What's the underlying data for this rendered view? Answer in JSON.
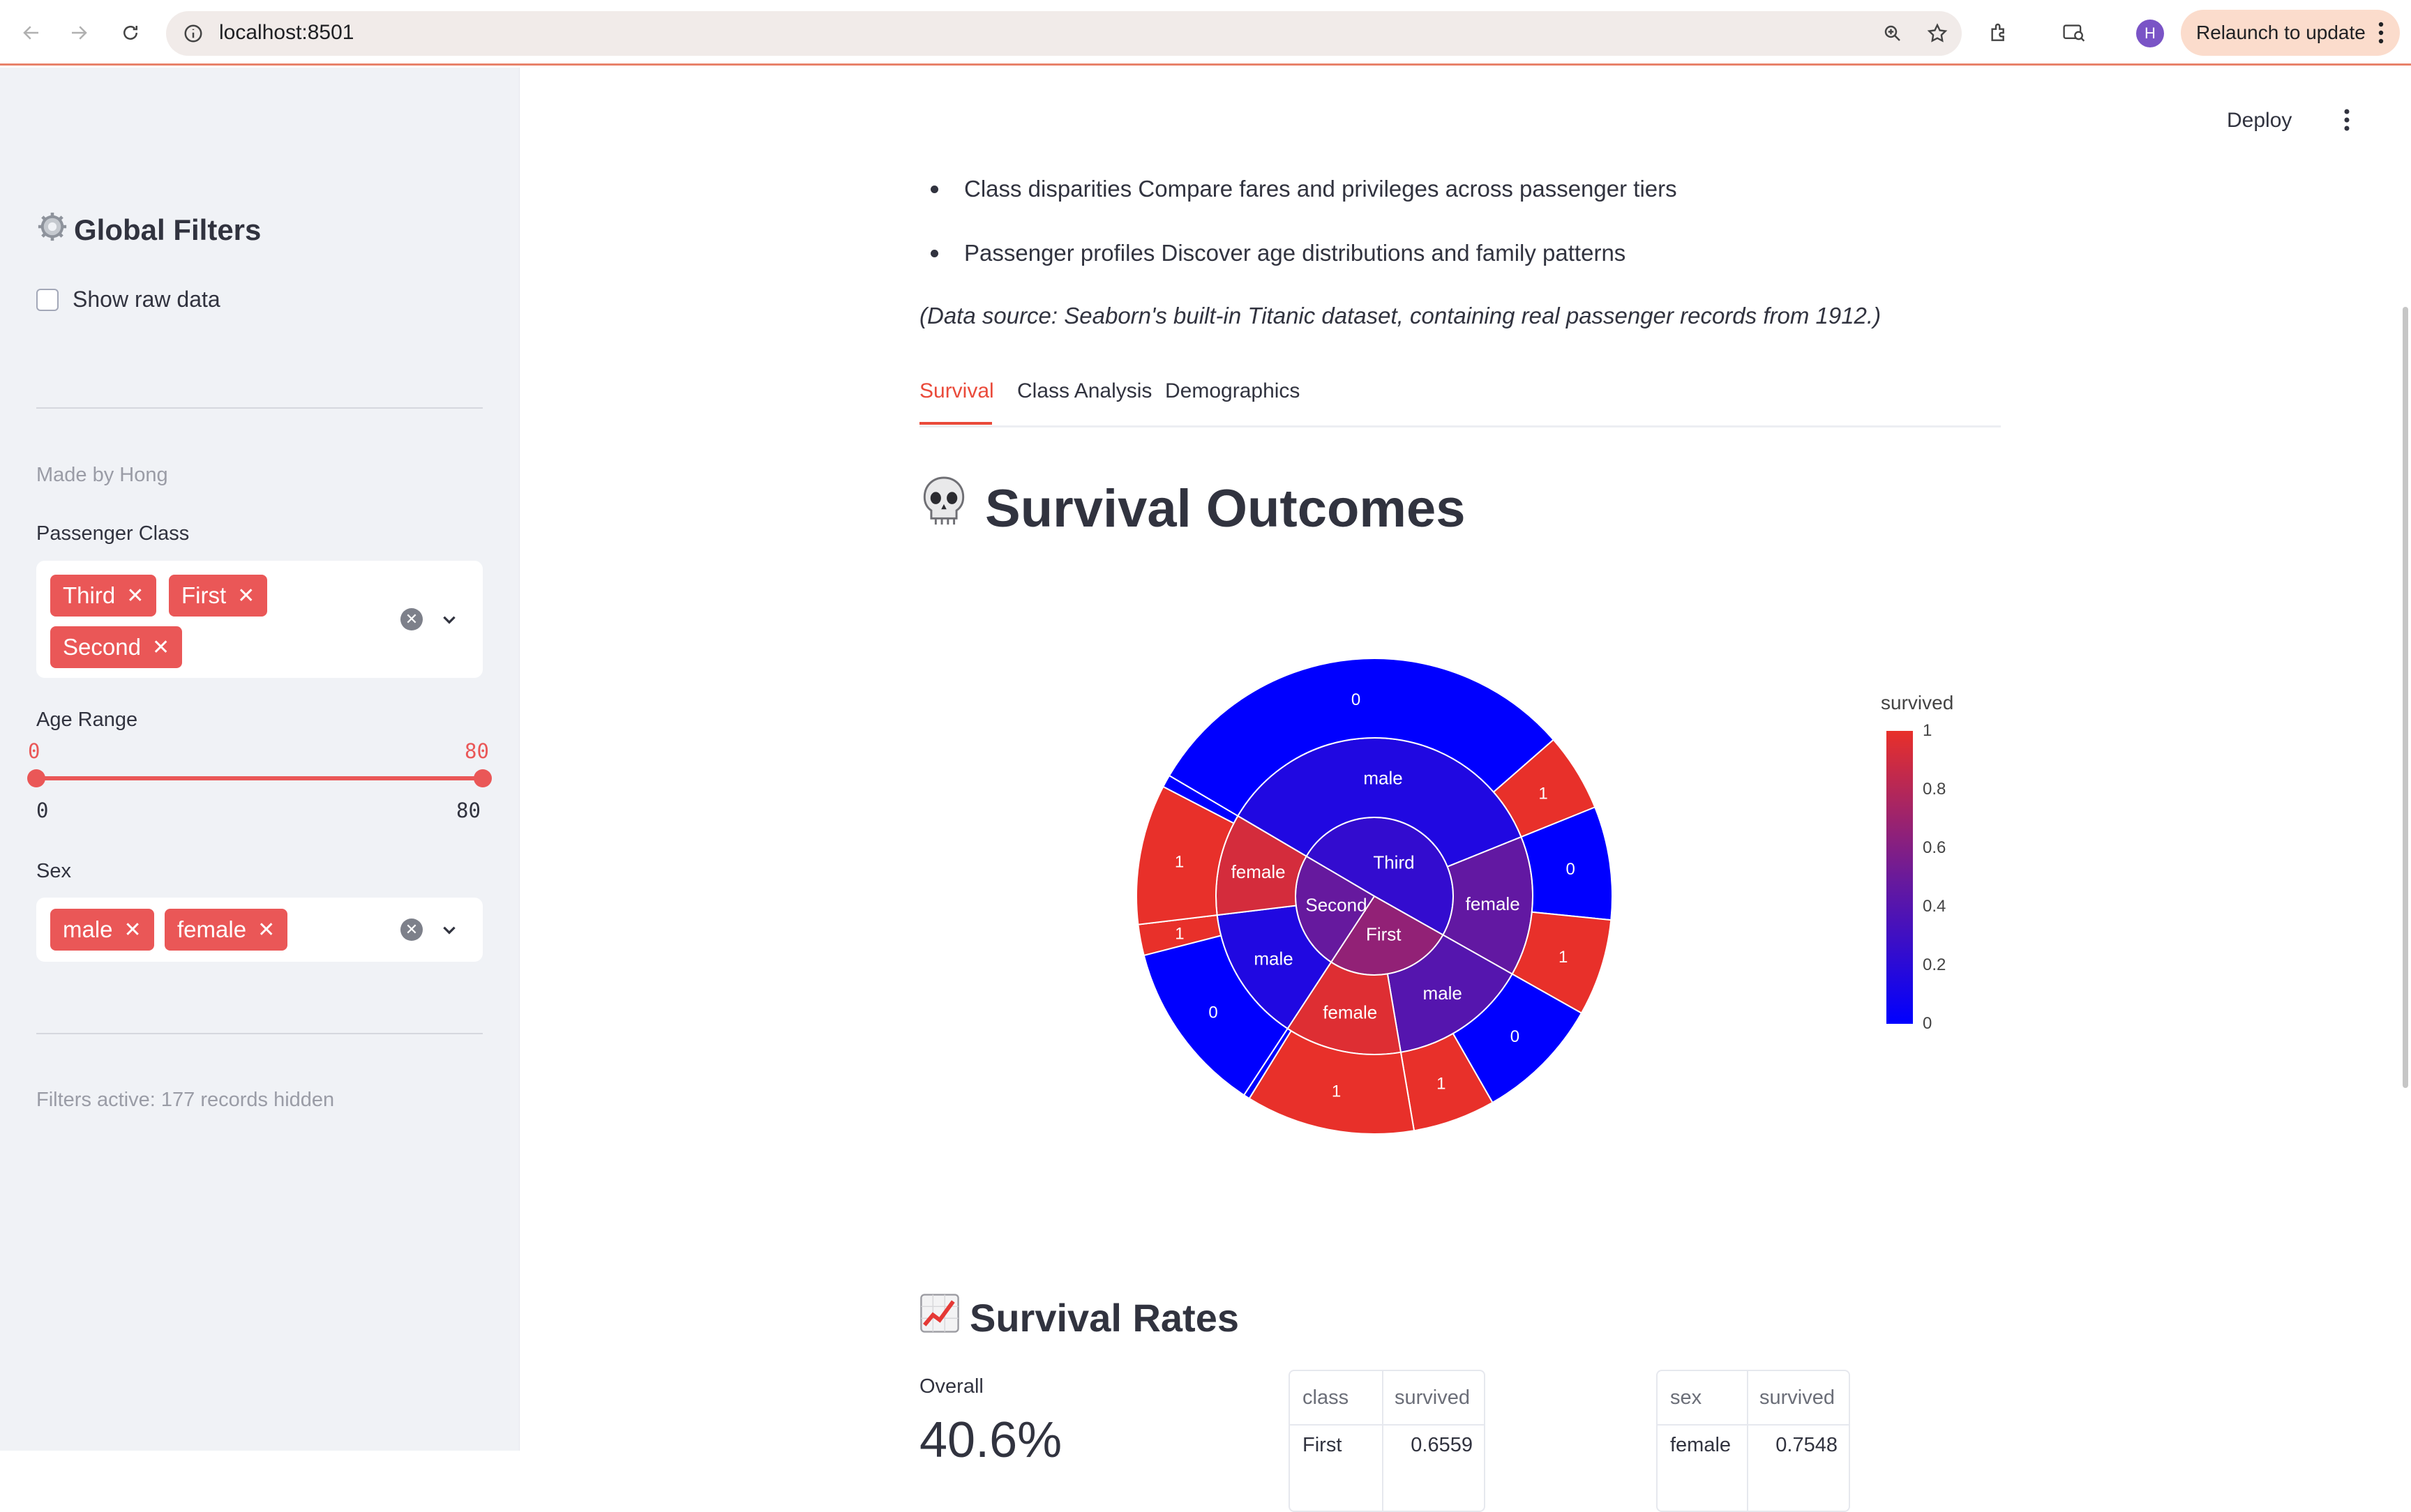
{
  "browser": {
    "url": "localhost:8501",
    "relaunch_label": "Relaunch to update",
    "profile_initial": "H"
  },
  "sidebar": {
    "title": "Global Filters",
    "show_raw_data_label": "Show raw data",
    "made_by": "Made by Hong",
    "passenger_class": {
      "label": "Passenger Class",
      "selected": [
        "Third",
        "First",
        "Second"
      ]
    },
    "age_range": {
      "label": "Age Range",
      "min_value": "0",
      "max_value": "80",
      "scale_min": "0",
      "scale_max": "80"
    },
    "sex": {
      "label": "Sex",
      "selected": [
        "male",
        "female"
      ]
    },
    "filters_status": "Filters active: 177 records hidden"
  },
  "main": {
    "deploy_label": "Deploy",
    "bullets": [
      "Class disparities Compare fares and privileges across passenger tiers",
      "Passenger profiles Discover age distributions and family patterns"
    ],
    "data_source": "(Data source: Seaborn's built-in Titanic dataset, containing real passenger records from 1912.)",
    "tabs": [
      "Survival",
      "Class Analysis",
      "Demographics"
    ],
    "active_tab": "Survival",
    "survival_heading": "Survival Outcomes",
    "rates_heading": "Survival Rates",
    "overall_label": "Overall",
    "overall_value": "40.6%",
    "class_table": {
      "headers": [
        "class",
        "survived"
      ],
      "first_row": [
        "First",
        "0.6559"
      ]
    },
    "sex_table": {
      "headers": [
        "sex",
        "survived"
      ],
      "first_row": [
        "female",
        "0.7548"
      ]
    }
  },
  "chart_data": {
    "type": "sunburst",
    "colorbar_title": "survived",
    "colorbar_ticks": [
      "1",
      "0.8",
      "0.6",
      "0.4",
      "0.2",
      "0"
    ],
    "colorscale": [
      "#0000ff",
      "#e8302a"
    ],
    "hierarchy": [
      {
        "label": "Third",
        "value": 355,
        "color_value": 0.24,
        "children": [
          {
            "label": "male",
            "value": 253,
            "color_value": 0.15,
            "children": [
              {
                "label": "0",
                "value": 215
              },
              {
                "label": "1",
                "value": 38
              }
            ]
          },
          {
            "label": "female",
            "value": 102,
            "color_value": 0.46,
            "children": [
              {
                "label": "0",
                "value": 55
              },
              {
                "label": "1",
                "value": 47
              }
            ]
          }
        ]
      },
      {
        "label": "First",
        "value": 186,
        "color_value": 0.66,
        "children": [
          {
            "label": "male",
            "value": 101,
            "color_value": 0.4,
            "children": [
              {
                "label": "0",
                "value": 61
              },
              {
                "label": "1",
                "value": 40
              }
            ]
          },
          {
            "label": "female",
            "value": 85,
            "color_value": 0.96,
            "children": [
              {
                "label": "1",
                "value": 82
              },
              {
                "label": "0",
                "value": 3
              }
            ]
          }
        ]
      },
      {
        "label": "Second",
        "value": 173,
        "color_value": 0.48,
        "children": [
          {
            "label": "male",
            "value": 99,
            "color_value": 0.15,
            "children": [
              {
                "label": "0",
                "value": 84
              },
              {
                "label": "1",
                "value": 15
              }
            ]
          },
          {
            "label": "female",
            "value": 74,
            "color_value": 0.92,
            "children": [
              {
                "label": "1",
                "value": 68
              },
              {
                "label": "0",
                "value": 6
              }
            ]
          }
        ]
      }
    ]
  }
}
